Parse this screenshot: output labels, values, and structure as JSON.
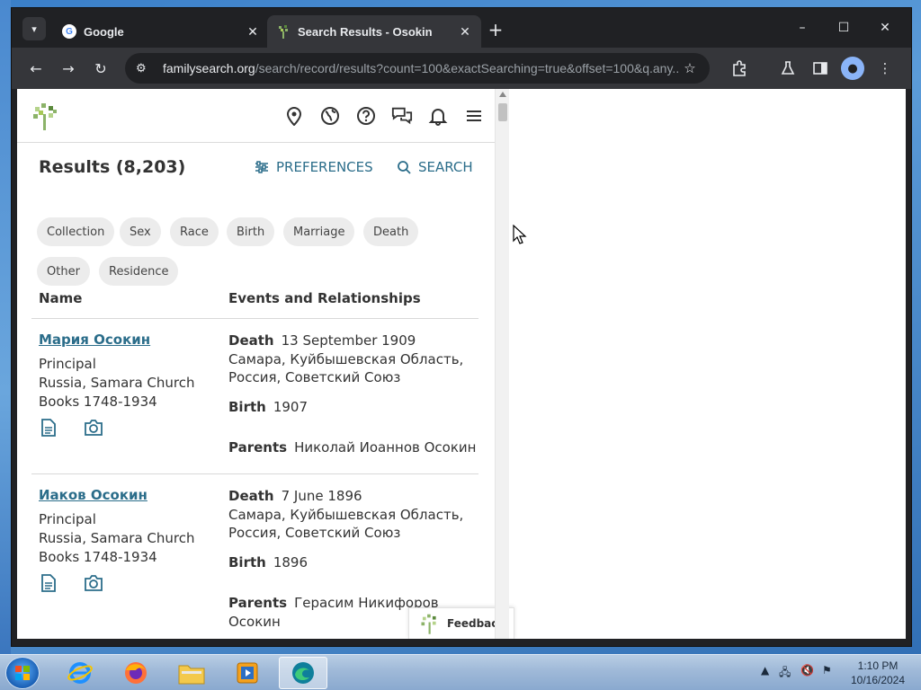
{
  "browser": {
    "tabs": [
      {
        "title": "Google",
        "active": false
      },
      {
        "title": "Search Results - Osokin",
        "active": true
      }
    ],
    "url_domain": "familysearch.org",
    "url_path": "/search/record/results?count=100&exactSearching=true&offset=100&q.any...",
    "window_controls": {
      "minimize": "–",
      "maximize": "☐",
      "close": "✕"
    }
  },
  "site": {
    "results_title": "Results (8,203)",
    "preferences_label": "PREFERENCES",
    "search_label": "SEARCH",
    "filters": [
      "Collection",
      "Sex",
      "Race",
      "Birth",
      "Marriage",
      "Death",
      "Other",
      "Residence"
    ],
    "columns": {
      "name": "Name",
      "events": "Events and Relationships"
    },
    "records": [
      {
        "name": "Мария Осокин",
        "role": "Principal",
        "collection": "Russia, Samara Church Books 1748-1934",
        "death_label": "Death",
        "death_date": "13 September 1909",
        "death_place": "Самара, Куйбышевская Область, Россия, Советский Союз",
        "birth_label": "Birth",
        "birth_date": "1907",
        "parents_label": "Parents",
        "parents": "Николай Иоаннов Осокин"
      },
      {
        "name": "Иаков Осокин",
        "role": "Principal",
        "collection": "Russia, Samara Church Books 1748-1934",
        "death_label": "Death",
        "death_date": "7 June 1896",
        "death_place": "Самара, Куйбышевская Область, Россия, Советский Союз",
        "birth_label": "Birth",
        "birth_date": "1896",
        "parents_label": "Parents",
        "parents": "Герасим Никифоров Осокин"
      }
    ],
    "feedback_label": "Feedback"
  },
  "taskbar": {
    "clock_time": "1:10 PM",
    "clock_date": "10/16/2024"
  },
  "colors": {
    "link": "#2b6d8a",
    "chip_bg": "#ececec",
    "chrome_dark": "#202124",
    "chrome_toolbar": "#35363a"
  }
}
